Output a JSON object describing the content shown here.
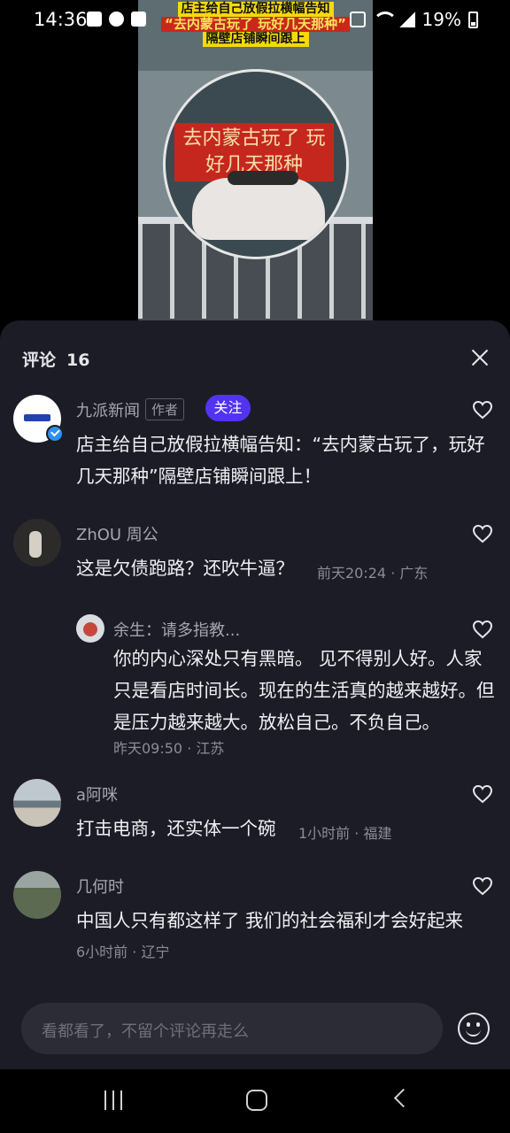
{
  "status_bar": {
    "time": "14:36",
    "battery": "19%"
  },
  "video": {
    "headline_line1": "店主给自己放假拉横幅告知",
    "headline_line2": "“去内蒙古玩了 玩好几天那种”",
    "headline_line3": "隔壁店铺瞬间跟上",
    "banner_text": "去内蒙古玩了 玩好几天那种"
  },
  "comments_sheet": {
    "title": "评论",
    "count": "16",
    "comments": [
      {
        "name": "九派新闻",
        "author_tag": "作者",
        "follow_label": "关注",
        "text": "店主给自己放假拉横幅告知：“去内蒙古玩了，玩好几天那种”隔壁店铺瞬间跟上！"
      },
      {
        "name": "ZhOU 周公",
        "text": "这是欠债跑路？还吹牛逼？",
        "meta": "前天20:24 · 广东"
      },
      {
        "name": "余生：请多指教...",
        "text": "你的内心深处只有黑暗。 见不得别人好。人家只是看店时间长。现在的生活真的越来越好。但是压力越来越大。放松自己。不负自己。",
        "meta": "昨天09:50 · 江苏"
      },
      {
        "name": "a阿咪",
        "text": "打击电商，还实体一个碗",
        "meta": "1小时前 · 福建"
      },
      {
        "name": "几何时",
        "text": "中国人只有都这样了 我们的社会福利才会好起来",
        "meta": "6小时前 · 辽宁"
      }
    ],
    "input_placeholder": "看都看了，不留个评论再走么"
  },
  "colors": {
    "sheet_bg": "#1c1c26",
    "follow_button": "#5233f0",
    "verified": "#2f8ff0"
  }
}
